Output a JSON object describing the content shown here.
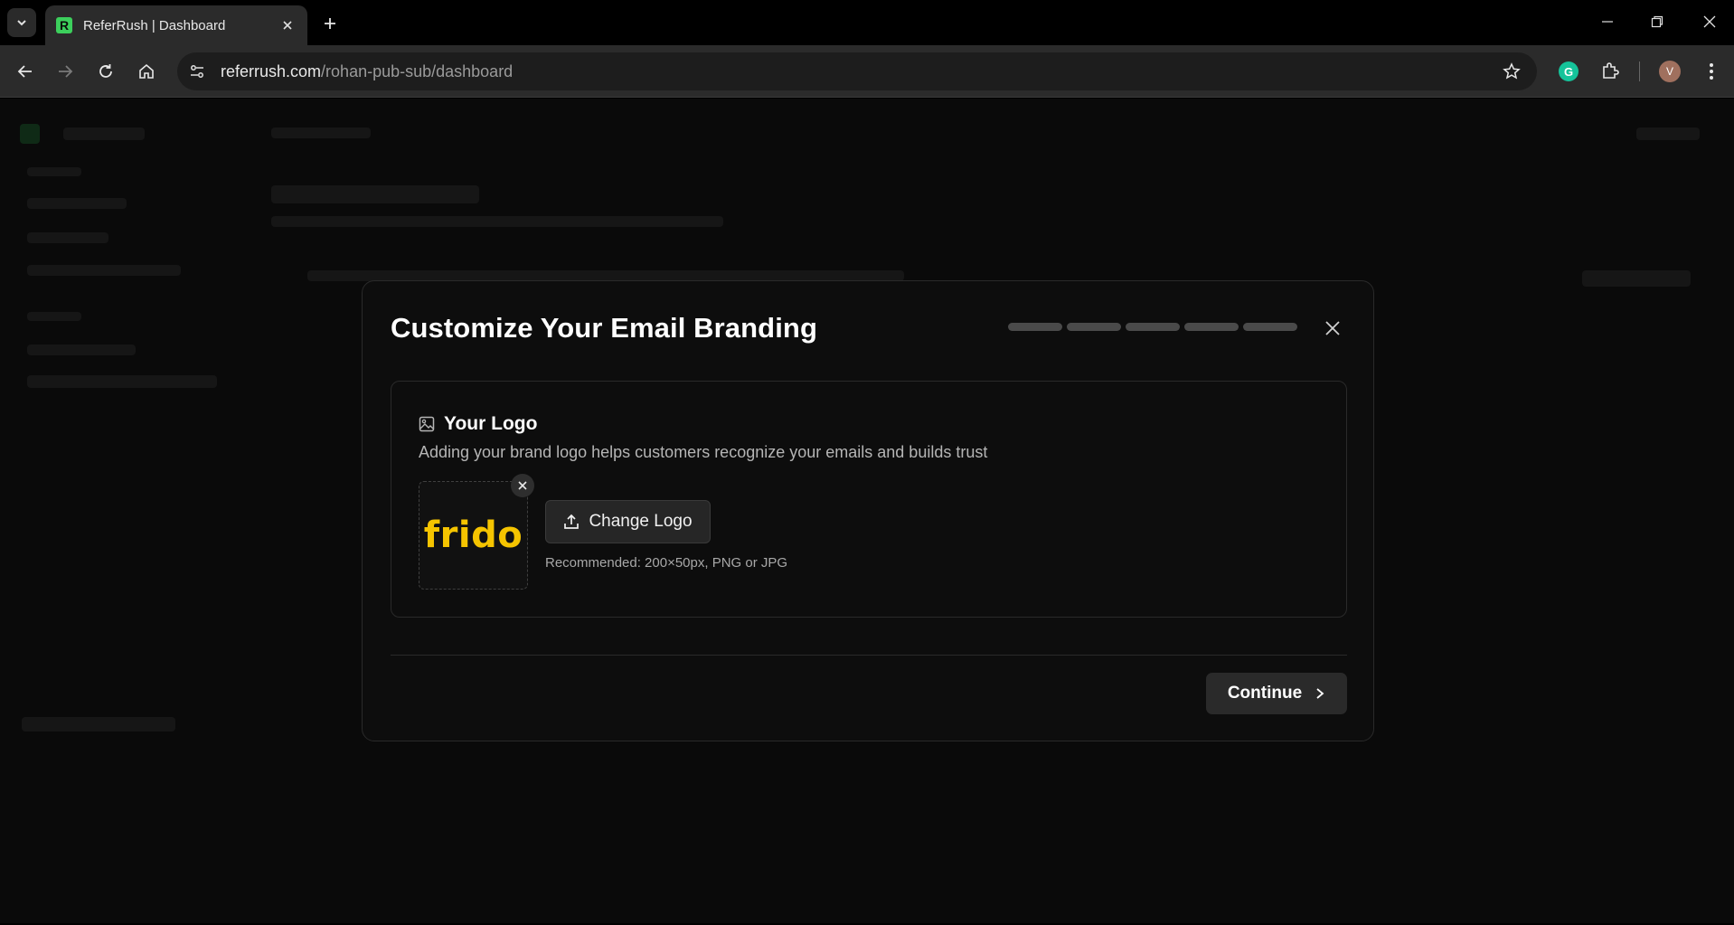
{
  "browser": {
    "tab_title": "ReferRush | Dashboard",
    "favicon_letter": "R",
    "url_host": "referrush.com",
    "url_path": "/rohan-pub-sub/dashboard",
    "profile_initial": "V",
    "extension_letter": "G"
  },
  "modal": {
    "title": "Customize Your Email Branding",
    "progress_steps": 5,
    "logo_section": {
      "title": "Your Logo",
      "description": "Adding your brand logo helps customers recognize your emails and builds trust",
      "logo_text": "frido",
      "change_button_label": "Change Logo",
      "recommendation": "Recommended: 200×50px, PNG or JPG"
    },
    "continue_label": "Continue"
  },
  "colors": {
    "brand_logo": "#f5c400",
    "favicon": "#3ccf5c"
  }
}
